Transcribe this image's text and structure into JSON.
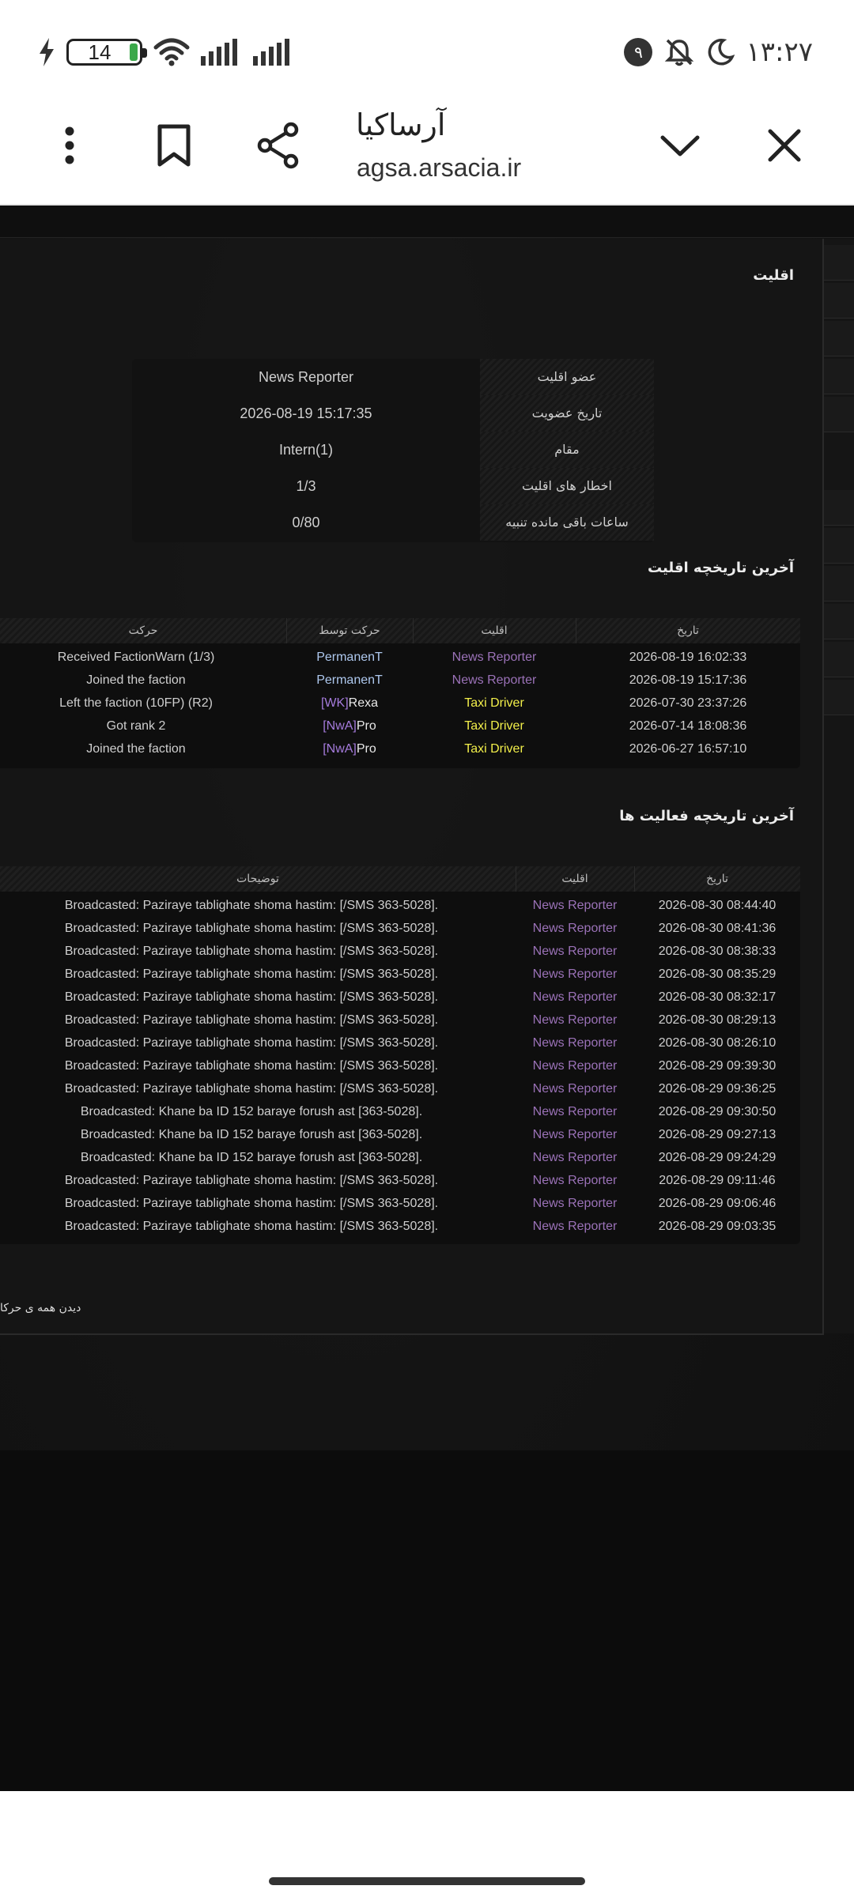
{
  "status_bar": {
    "battery_level": "14",
    "notification_count": "۹",
    "time": "۱۳:۲۷"
  },
  "browser": {
    "site_title": "آرساکیا",
    "site_url": "agsa.arsacia.ir"
  },
  "faction_info": {
    "title": "اقلیت",
    "rows": [
      {
        "label": "عضو اقلیت",
        "value": "News Reporter"
      },
      {
        "label": "تاریخ عضویت",
        "value": "2026-08-19 15:17:35"
      },
      {
        "label": "مقام",
        "value": "Intern(1)"
      },
      {
        "label": "اخطار های اقلیت",
        "value": "1/3"
      },
      {
        "label": "ساعات باقی مانده تنبیه",
        "value": "0/80"
      }
    ]
  },
  "faction_history": {
    "title": "آخرین تاریخچه اقلیت",
    "headers": {
      "date": "تاریخ",
      "faction": "اقلیت",
      "by": "حرکت توسط",
      "action": "حرکت"
    },
    "rows": [
      {
        "date": "2026-08-19 16:02:33",
        "faction": "News Reporter",
        "by_tag": "",
        "by_name": "PermanenT",
        "action": "Received FactionWarn (1/3)"
      },
      {
        "date": "2026-08-19 15:17:36",
        "faction": "News Reporter",
        "by_tag": "",
        "by_name": "PermanenT",
        "action": "Joined the faction"
      },
      {
        "date": "2026-07-30 23:37:26",
        "faction": "Taxi Driver",
        "by_tag": "[WK]",
        "by_name": "Rexa",
        "action": "Left the faction (10FP) (R2)"
      },
      {
        "date": "2026-07-14 18:08:36",
        "faction": "Taxi Driver",
        "by_tag": "[NwA]",
        "by_name": "Pro",
        "action": "Got rank 2"
      },
      {
        "date": "2026-06-27 16:57:10",
        "faction": "Taxi Driver",
        "by_tag": "[NwA]",
        "by_name": "Pro",
        "action": "Joined the faction"
      }
    ]
  },
  "activity_history": {
    "title": "آخرین تاریخچه فعالیت ها",
    "headers": {
      "date": "تاریخ",
      "faction": "اقلیت",
      "description": "توضیحات"
    },
    "rows": [
      {
        "date": "2026-08-30 08:44:40",
        "faction": "News Reporter",
        "description": "Broadcasted: Paziraye tablighate shoma hastim: [/SMS 363-5028]."
      },
      {
        "date": "2026-08-30 08:41:36",
        "faction": "News Reporter",
        "description": "Broadcasted: Paziraye tablighate shoma hastim: [/SMS 363-5028]."
      },
      {
        "date": "2026-08-30 08:38:33",
        "faction": "News Reporter",
        "description": "Broadcasted: Paziraye tablighate shoma hastim: [/SMS 363-5028]."
      },
      {
        "date": "2026-08-30 08:35:29",
        "faction": "News Reporter",
        "description": "Broadcasted: Paziraye tablighate shoma hastim: [/SMS 363-5028]."
      },
      {
        "date": "2026-08-30 08:32:17",
        "faction": "News Reporter",
        "description": "Broadcasted: Paziraye tablighate shoma hastim: [/SMS 363-5028]."
      },
      {
        "date": "2026-08-30 08:29:13",
        "faction": "News Reporter",
        "description": "Broadcasted: Paziraye tablighate shoma hastim: [/SMS 363-5028]."
      },
      {
        "date": "2026-08-30 08:26:10",
        "faction": "News Reporter",
        "description": "Broadcasted: Paziraye tablighate shoma hastim: [/SMS 363-5028]."
      },
      {
        "date": "2026-08-29 09:39:30",
        "faction": "News Reporter",
        "description": "Broadcasted: Paziraye tablighate shoma hastim: [/SMS 363-5028]."
      },
      {
        "date": "2026-08-29 09:36:25",
        "faction": "News Reporter",
        "description": "Broadcasted: Paziraye tablighate shoma hastim: [/SMS 363-5028]."
      },
      {
        "date": "2026-08-29 09:30:50",
        "faction": "News Reporter",
        "description": "Broadcasted: Khane ba ID 152 baraye forush ast [363-5028]."
      },
      {
        "date": "2026-08-29 09:27:13",
        "faction": "News Reporter",
        "description": "Broadcasted: Khane ba ID 152 baraye forush ast [363-5028]."
      },
      {
        "date": "2026-08-29 09:24:29",
        "faction": "News Reporter",
        "description": "Broadcasted: Khane ba ID 152 baraye forush ast [363-5028]."
      },
      {
        "date": "2026-08-29 09:11:46",
        "faction": "News Reporter",
        "description": "Broadcasted: Paziraye tablighate shoma hastim: [/SMS 363-5028]."
      },
      {
        "date": "2026-08-29 09:06:46",
        "faction": "News Reporter",
        "description": "Broadcasted: Paziraye tablighate shoma hastim: [/SMS 363-5028]."
      },
      {
        "date": "2026-08-29 09:03:35",
        "faction": "News Reporter",
        "description": "Broadcasted: Paziraye tablighate shoma hastim: [/SMS 363-5028]."
      }
    ],
    "see_all": "دیدن همه ی حرکا"
  },
  "colors": {
    "news_reporter": "#9b72b8",
    "taxi_driver": "#f2ef4a",
    "user_name": "#aec8ee",
    "tag": "#a57bdc"
  }
}
